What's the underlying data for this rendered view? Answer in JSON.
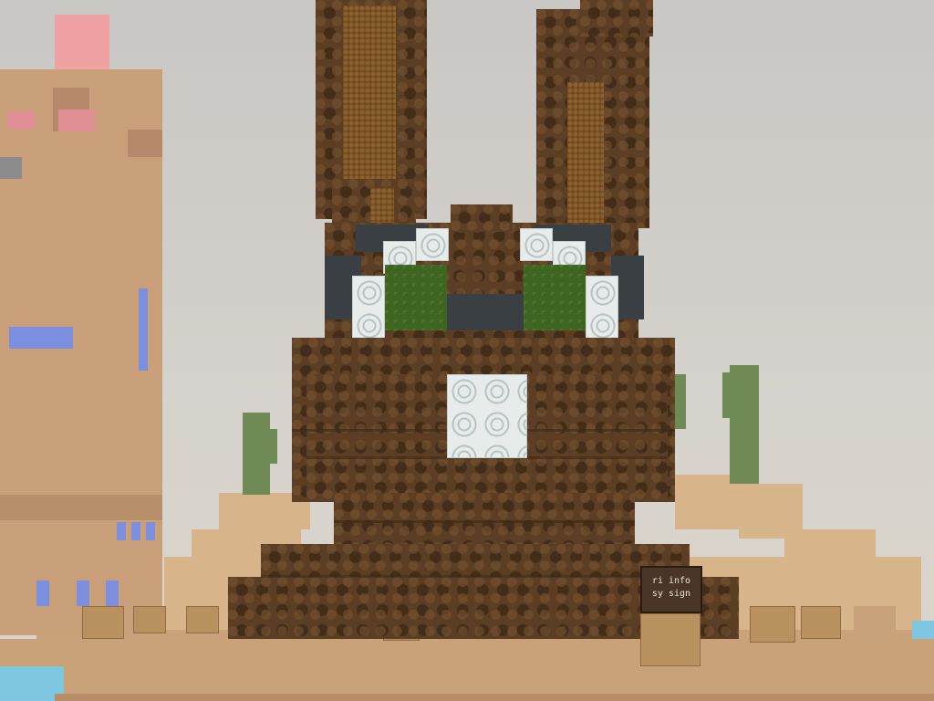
{
  "game": {
    "scene": "voxel-world",
    "sign_text_line1": "ri info",
    "sign_text_line2": "sy sign"
  },
  "colors": {
    "dirt": "#5b3e23",
    "eye_green": "#3e6621",
    "eye_white": "#e7eceb",
    "sand": "#c9a27a",
    "sky": "#cfcbc6",
    "building": "#caa07a",
    "window_blue": "#7d90e0",
    "water": "#7fc6e0"
  }
}
